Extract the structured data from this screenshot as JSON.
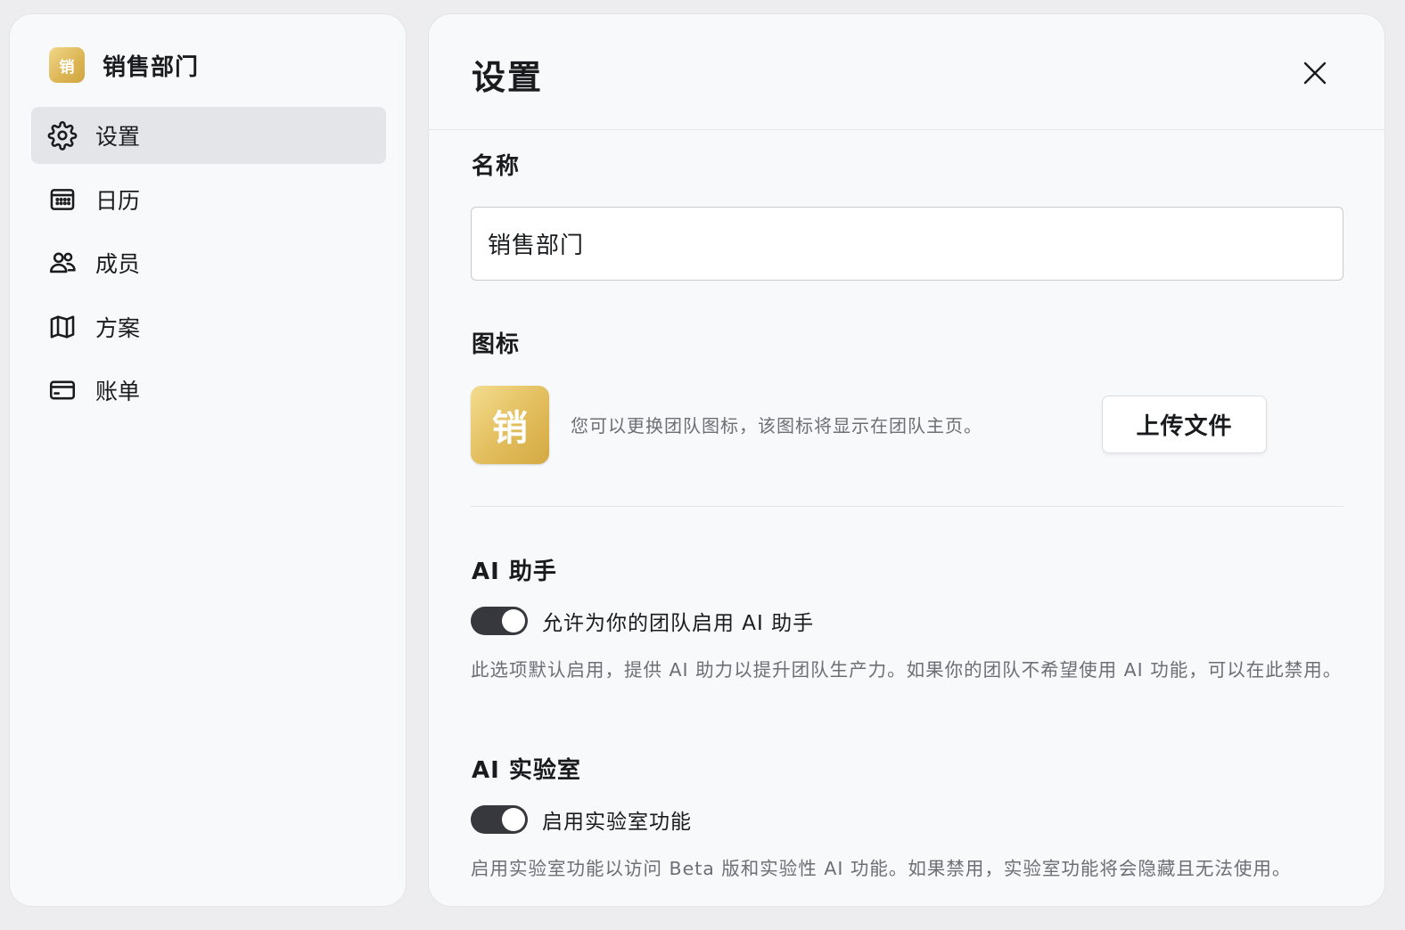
{
  "sidebar": {
    "team_logo_char": "销",
    "team_name": "销售部门",
    "items": [
      {
        "label": "设置",
        "icon": "gear-icon",
        "active": true
      },
      {
        "label": "日历",
        "icon": "calendar-icon",
        "active": false
      },
      {
        "label": "成员",
        "icon": "users-icon",
        "active": false
      },
      {
        "label": "方案",
        "icon": "map-icon",
        "active": false
      },
      {
        "label": "账单",
        "icon": "credit-card-icon",
        "active": false
      }
    ]
  },
  "main": {
    "title": "设置",
    "close_icon": "close-icon",
    "name_section": {
      "label": "名称",
      "value": "销售部门"
    },
    "icon_section": {
      "label": "图标",
      "icon_char": "销",
      "description": "您可以更换团队图标，该图标将显示在团队主页。",
      "upload_label": "上传文件"
    },
    "ai_assistant": {
      "label": "AI 助手",
      "toggle_label": "允许为你的团队启用 AI 助手",
      "enabled": true,
      "help": "此选项默认启用，提供 AI 助力以提升团队生产力。如果你的团队不希望使用 AI 功能，可以在此禁用。"
    },
    "ai_lab": {
      "label": "AI 实验室",
      "toggle_label": "启用实验室功能",
      "enabled": true,
      "help": "启用实验室功能以访问 Beta 版和实验性 AI 功能。如果禁用，实验室功能将会隐藏且无法使用。"
    }
  },
  "colors": {
    "toggle_on": "#36383d",
    "logo_gold": "#dcb453",
    "active_nav_bg": "#e3e5e8"
  }
}
